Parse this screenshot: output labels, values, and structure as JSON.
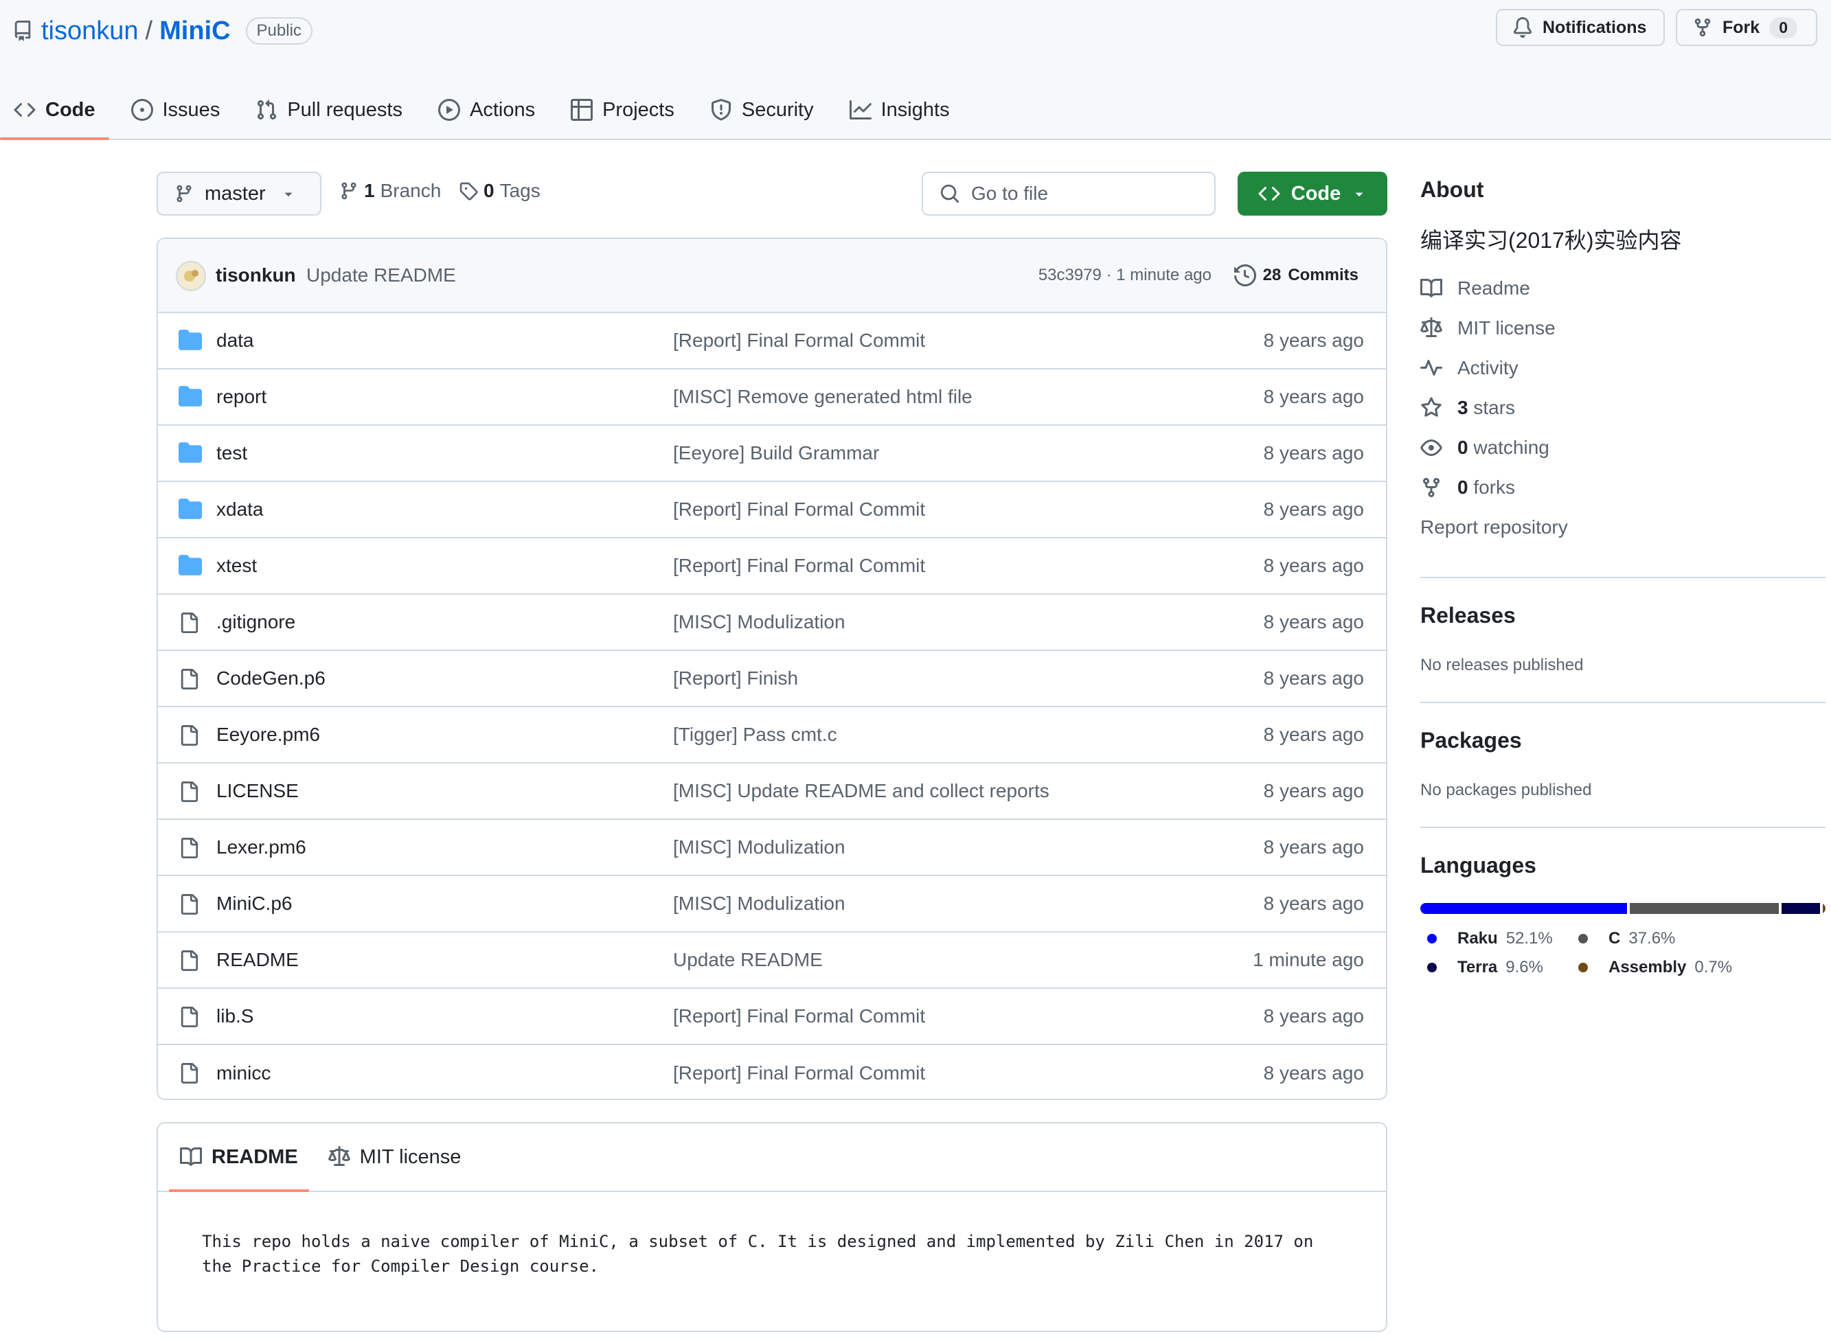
{
  "repo": {
    "owner": "tisonkun",
    "separator": "/",
    "name": "MiniC",
    "visibility": "Public"
  },
  "header_actions": {
    "notifications_label": "Notifications",
    "fork_label": "Fork",
    "fork_count": "0"
  },
  "nav_tabs": [
    {
      "label": "Code",
      "icon": "code-icon",
      "active": true
    },
    {
      "label": "Issues",
      "icon": "issue-opened-icon"
    },
    {
      "label": "Pull requests",
      "icon": "git-pull-request-icon"
    },
    {
      "label": "Actions",
      "icon": "play-icon"
    },
    {
      "label": "Projects",
      "icon": "table-icon"
    },
    {
      "label": "Security",
      "icon": "shield-icon"
    },
    {
      "label": "Insights",
      "icon": "graph-icon"
    }
  ],
  "toolbar": {
    "branch": "master",
    "branch_count": "1",
    "branch_label": "Branch",
    "tag_count": "0",
    "tag_label": "Tags",
    "go_to_file_placeholder": "Go to file",
    "code_button_label": "Code"
  },
  "latest_commit": {
    "author": "tisonkun",
    "message": "Update README",
    "hash_time": "53c3979 · 1 minute ago",
    "commits_count": "28",
    "commits_label": "Commits"
  },
  "files": [
    {
      "type": "dir",
      "name": "data",
      "message": "[Report] Final Formal Commit",
      "age": "8 years ago"
    },
    {
      "type": "dir",
      "name": "report",
      "message": "[MISC] Remove generated html file",
      "age": "8 years ago"
    },
    {
      "type": "dir",
      "name": "test",
      "message": "[Eeyore] Build Grammar",
      "age": "8 years ago"
    },
    {
      "type": "dir",
      "name": "xdata",
      "message": "[Report] Final Formal Commit",
      "age": "8 years ago"
    },
    {
      "type": "dir",
      "name": "xtest",
      "message": "[Report] Final Formal Commit",
      "age": "8 years ago"
    },
    {
      "type": "file",
      "name": ".gitignore",
      "message": "[MISC] Modulization",
      "age": "8 years ago"
    },
    {
      "type": "file",
      "name": "CodeGen.p6",
      "message": "[Report] Finish",
      "age": "8 years ago"
    },
    {
      "type": "file",
      "name": "Eeyore.pm6",
      "message": "[Tigger] Pass cmt.c",
      "age": "8 years ago"
    },
    {
      "type": "file",
      "name": "LICENSE",
      "message": "[MISC] Update README and collect reports",
      "age": "8 years ago"
    },
    {
      "type": "file",
      "name": "Lexer.pm6",
      "message": "[MISC] Modulization",
      "age": "8 years ago"
    },
    {
      "type": "file",
      "name": "MiniC.p6",
      "message": "[MISC] Modulization",
      "age": "8 years ago"
    },
    {
      "type": "file",
      "name": "README",
      "message": "Update README",
      "age": "1 minute ago"
    },
    {
      "type": "file",
      "name": "lib.S",
      "message": "[Report] Final Formal Commit",
      "age": "8 years ago"
    },
    {
      "type": "file",
      "name": "minicc",
      "message": "[Report] Final Formal Commit",
      "age": "8 years ago"
    }
  ],
  "readme": {
    "tab_readme": "README",
    "tab_license": "MIT license",
    "content": "This repo holds a naive compiler of MiniC, a subset of C. It is designed and implemented by Zili Chen in 2017 on\nthe Practice for Compiler Design course."
  },
  "about": {
    "heading": "About",
    "description": "编译实习(2017秋)实验内容",
    "readme_link": "Readme",
    "license_link": "MIT license",
    "activity_link": "Activity",
    "stars_count": "3",
    "stars_label": "stars",
    "watching_count": "0",
    "watching_label": "watching",
    "forks_count": "0",
    "forks_label": "forks",
    "report_link": "Report repository"
  },
  "releases": {
    "heading": "Releases",
    "text": "No releases published"
  },
  "packages": {
    "heading": "Packages",
    "text": "No packages published"
  },
  "languages": {
    "heading": "Languages",
    "items": [
      {
        "name": "Raku",
        "percent": "52.1%",
        "value": 52.1,
        "color": "#0000fb"
      },
      {
        "name": "C",
        "percent": "37.6%",
        "value": 37.6,
        "color": "#555555"
      },
      {
        "name": "Terra",
        "percent": "9.6%",
        "value": 9.6,
        "color": "#00004c"
      },
      {
        "name": "Assembly",
        "percent": "0.7%",
        "value": 0.7,
        "color": "#6e4c13"
      }
    ]
  },
  "colors": {
    "link": "#0969da",
    "green_button": "#1f883d",
    "folder": "#54aeff",
    "tab_underline": "#fd8c73"
  }
}
